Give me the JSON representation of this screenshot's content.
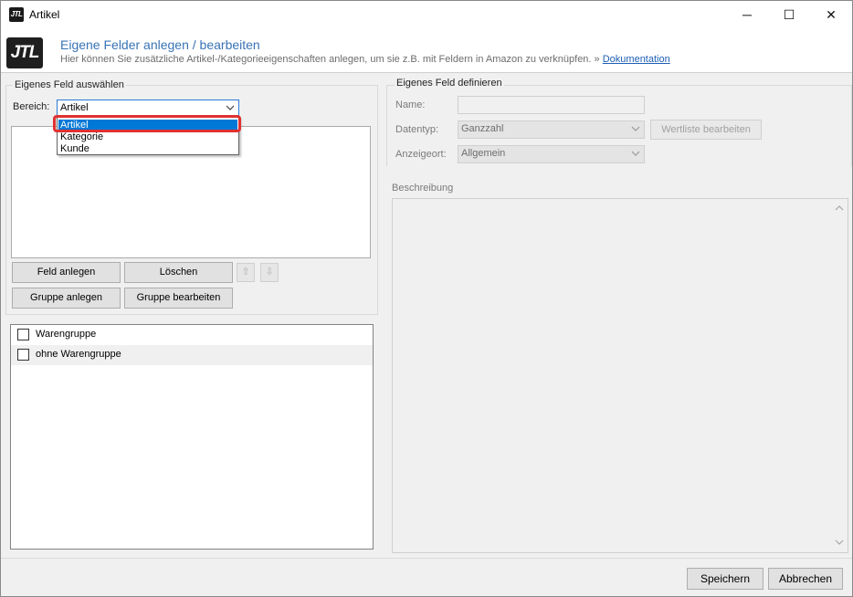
{
  "window": {
    "title": "Artikel",
    "app_icon": "jtl-logo-icon",
    "controls": {
      "minimize": "─",
      "maximize": "☐",
      "close": "✕"
    }
  },
  "header": {
    "logo_text": "JTL",
    "title": "Eigene Felder anlegen / bearbeiten",
    "subtitle": "Hier können Sie zusätzliche Artikel-/Kategorieeigenschaften anlegen, um sie z.B. mit Feldern in Amazon zu verknüpfen.",
    "link_prefix": "»",
    "link_text": "Dokumentation"
  },
  "left_panel": {
    "legend": "Eigenes Feld auswählen",
    "bereich_label": "Bereich:",
    "bereich_value": "Artikel",
    "bereich_options": [
      "Artikel",
      "Kategorie",
      "Kunde"
    ],
    "selected_option": "Artikel",
    "buttons": {
      "feld_anlegen": "Feld anlegen",
      "loeschen": "Löschen",
      "up": "⇧",
      "down": "⇩",
      "gruppe_anlegen": "Gruppe anlegen",
      "gruppe_bearbeiten": "Gruppe bearbeiten"
    },
    "groups": [
      {
        "label": "Warengruppe",
        "checked": false
      },
      {
        "label": "ohne Warengruppe",
        "checked": false
      }
    ]
  },
  "right_panel": {
    "legend": "Eigenes Feld definieren",
    "name_label": "Name:",
    "name_value": "",
    "datentyp_label": "Datentyp:",
    "datentyp_value": "Ganzzahl",
    "wertliste_button": "Wertliste bearbeiten",
    "anzeigeort_label": "Anzeigeort:",
    "anzeigeort_value": "Allgemein",
    "beschreibung_label": "Beschreibung"
  },
  "footer": {
    "save": "Speichern",
    "cancel": "Abbrechen"
  },
  "colors": {
    "accent": "#0078d7",
    "header_title": "#3973b6",
    "highlight": "#e03131"
  }
}
